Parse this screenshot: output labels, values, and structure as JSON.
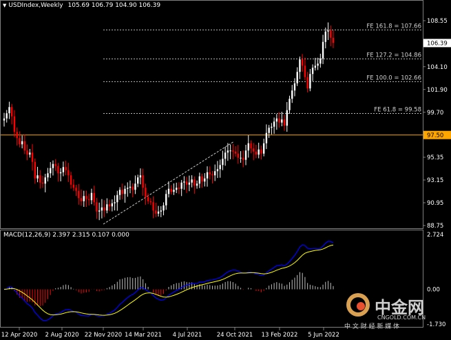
{
  "chart": {
    "header": {
      "arrow": "▼",
      "symbol": "USDIndex,Weekly",
      "ohlc": "105.69 106.79 104.90 106.39"
    },
    "price_panel": {
      "y_ticks": [
        "108.55",
        "106.39",
        "104.10",
        "101.90",
        "99.70",
        "97.50",
        "95.35",
        "93.15",
        "90.95",
        "88.75"
      ],
      "current_price": "106.39",
      "hline_price": "97.50",
      "fib_levels": [
        {
          "label": "FE 161.8 = 107.66",
          "value": 107.66
        },
        {
          "label": "FE 127.2 = 104.86",
          "value": 104.86
        },
        {
          "label": "FE 100.0 = 102.66",
          "value": 102.66
        },
        {
          "label": "FE 61.8 = 99.58",
          "value": 99.58
        }
      ]
    },
    "macd_panel": {
      "title": "MACD(12,26,9) 2.397 2.315 0.107 0.000",
      "y_ticks": [
        "2.724",
        "0.00",
        "-1.730"
      ]
    },
    "x_axis": [
      "12 Apr 2020",
      "2 Aug 2020",
      "22 Nov 2020",
      "14 Mar 2021",
      "4 Jul 2021",
      "24 Oct 2021",
      "13 Feb 2022",
      "5 Jun 2022"
    ],
    "colors": {
      "bull": "#ffffff",
      "bear": "#ff0000",
      "hline": "#ffa500",
      "macd_line": "#0000ff",
      "signal_line": "#ffff00",
      "hist_pos": "#c0c0c0",
      "hist_neg": "#ff0000"
    }
  },
  "watermark": {
    "brand_cn": "中金网",
    "site": "CNGOLD.COM.CN",
    "tagline_cn": "中 文 财 经 新 媒 体"
  },
  "chart_data": {
    "type": "candlestick",
    "series_close": [
      99.1,
      99.6,
      100.2,
      99.3,
      97.8,
      97.2,
      96.6,
      96.9,
      96.0,
      95.6,
      95.8,
      94.9,
      93.3,
      93.6,
      92.9,
      92.8,
      93.4,
      93.8,
      94.3,
      94.7,
      94.5,
      93.8,
      93.9,
      94.4,
      94.1,
      93.6,
      92.7,
      92.4,
      92.1,
      91.4,
      91.1,
      91.6,
      91.3,
      91.2,
      91.9,
      91.0,
      90.1,
      90.2,
      90.5,
      90.2,
      90.8,
      90.6,
      90.9,
      91.0,
      91.7,
      92.2,
      91.8,
      92.3,
      92.4,
      92.5,
      92.2,
      92.8,
      93.4,
      93.6,
      92.4,
      91.5,
      91.1,
      91.0,
      90.2,
      89.9,
      90.1,
      90.2,
      90.7,
      91.8,
      92.3,
      92.0,
      92.2,
      92.4,
      92.3,
      92.9,
      93.0,
      92.7,
      92.9,
      93.2,
      92.6,
      92.8,
      93.5,
      93.0,
      93.3,
      93.9,
      93.7,
      93.6,
      94.0,
      94.2,
      94.6,
      95.2,
      95.8,
      96.0,
      96.0,
      95.9,
      95.7,
      95.3,
      95.3,
      95.1,
      96.0,
      96.7,
      96.2,
      95.9,
      95.6,
      96.1,
      95.7,
      96.7,
      97.7,
      98.2,
      98.3,
      98.8,
      99.1,
      98.7,
      99.0,
      98.4,
      99.9,
      101.0,
      101.8,
      102.5,
      103.6,
      104.8,
      104.2,
      103.1,
      102.0,
      103.4,
      104.0,
      104.2,
      104.4,
      104.9,
      106.5,
      107.5,
      107.6,
      106.9,
      106.4
    ],
    "yrange": [
      88.75,
      108.55
    ],
    "fib_extension": [
      107.66,
      104.86,
      102.66,
      99.58
    ],
    "horizontal_line": 97.5,
    "macd": {
      "macd": 2.397,
      "signal": 2.315,
      "histogram": 0.107
    }
  }
}
